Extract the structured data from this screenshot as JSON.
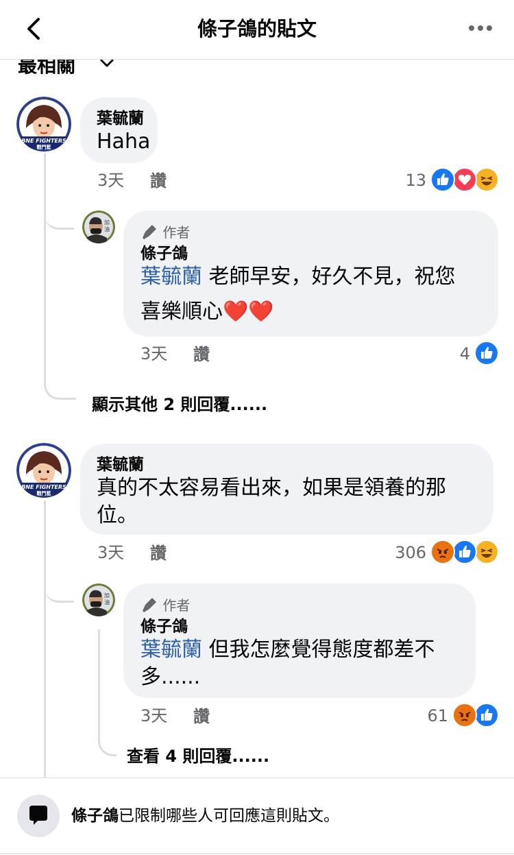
{
  "header": {
    "title": "條子鴿的貼文"
  },
  "sort": {
    "label": "最相關"
  },
  "comments": [
    {
      "name": "葉毓蘭",
      "text": "Haha",
      "time": "3天",
      "like_label": "讚",
      "reaction_count": "13",
      "reply": {
        "author_tag": "作者",
        "name": "條子鴿",
        "mention": "葉毓蘭",
        "line1": "老師早安，好久不見，祝您",
        "line2": "喜樂順心❤️❤️",
        "time": "3天",
        "like_label": "讚",
        "reaction_count": "4"
      },
      "more_replies": "顯示其他 2 則回覆......"
    },
    {
      "name": "葉毓蘭",
      "line1": "真的不太容易看出來，如果是領養的那",
      "line2": "位。",
      "time": "3天",
      "like_label": "讚",
      "reaction_count": "306",
      "reply": {
        "author_tag": "作者",
        "name": "條子鴿",
        "mention": "葉毓蘭",
        "line1": "但我怎麼覺得態度都差不",
        "line2": "多......",
        "time": "3天",
        "like_label": "讚",
        "reaction_count": "61"
      },
      "more_replies": "查看 4 則回覆......"
    }
  ],
  "avatar_texts": {
    "commenter": "FINE FIGHTERS 戰鬥藍",
    "author": "加油"
  },
  "footer": {
    "name": "條子鴿",
    "text": "已限制哪些人可回應這則貼文。"
  },
  "colors": {
    "like": "#1877f2",
    "love": "#f33e58",
    "haha": "#f7b125",
    "angry": "#e9710f",
    "mention": "#2e5fab"
  }
}
